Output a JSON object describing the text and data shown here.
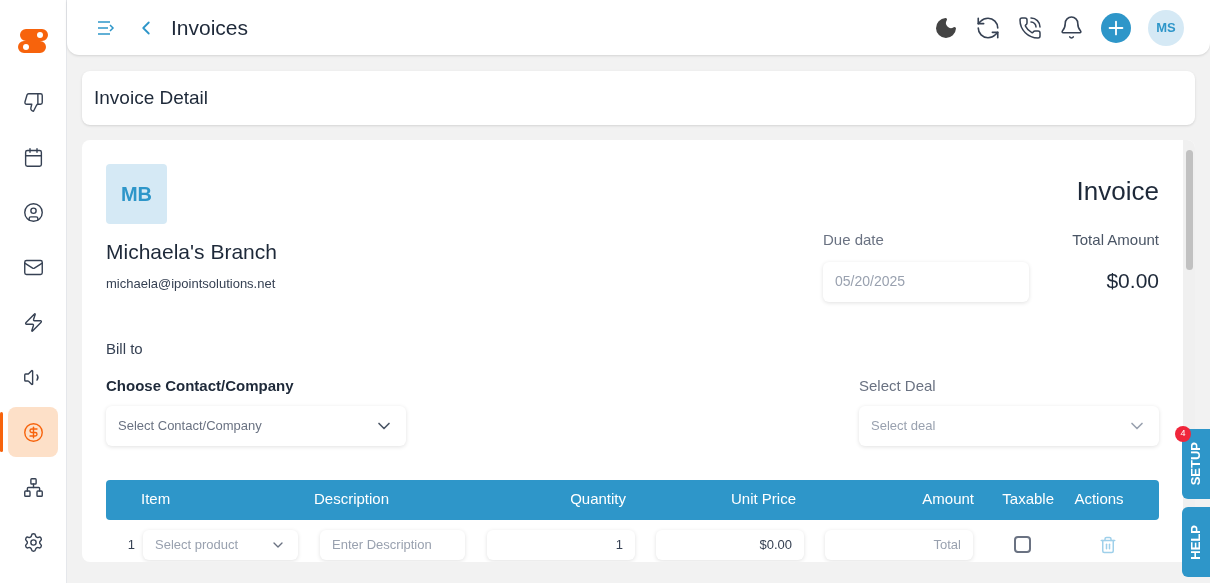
{
  "sidebar": {
    "items": [
      {
        "selected": false
      },
      {
        "selected": false
      },
      {
        "selected": false
      },
      {
        "selected": false
      },
      {
        "selected": false
      },
      {
        "selected": false
      },
      {
        "selected": true
      },
      {
        "selected": false
      },
      {
        "selected": false
      }
    ]
  },
  "header": {
    "title": "Invoices",
    "avatar": "MS"
  },
  "page_title": "Invoice Detail",
  "invoice": {
    "logo": "MB",
    "heading": "Invoice",
    "company": "Michaela's Branch",
    "email": "michaela@ipointsolutions.net",
    "due_date": {
      "label": "Due date",
      "value": "05/20/2025"
    },
    "total": {
      "label": "Total Amount",
      "value": "$0.00"
    },
    "bill_to": "Bill to",
    "contact": {
      "label": "Choose Contact/Company",
      "placeholder": "Select Contact/Company"
    },
    "deal": {
      "label": "Select Deal",
      "placeholder": "Select deal"
    }
  },
  "table": {
    "columns": [
      "Item",
      "Description",
      "Quantity",
      "Unit Price",
      "Amount",
      "Taxable",
      "Actions"
    ],
    "rows": [
      {
        "number": "1",
        "product": "Select product",
        "description": "Enter Description",
        "quantity": "1",
        "unit_price": "$0.00",
        "amount": "Total",
        "taxable": false
      }
    ]
  },
  "side_tabs": [
    {
      "label": "SETUP",
      "badge": "4"
    },
    {
      "label": "HELP"
    }
  ]
}
